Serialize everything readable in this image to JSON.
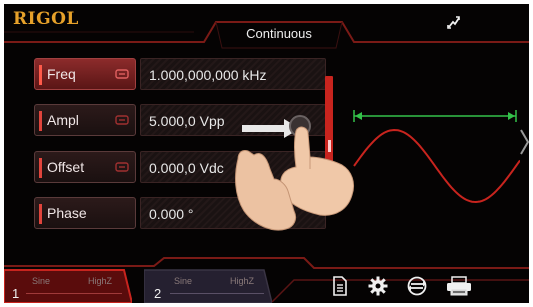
{
  "header": {
    "brand": "RIGOL",
    "mode_title": "Continuous"
  },
  "parameters": [
    {
      "label": "Freq",
      "value": "1.000,000,000 kHz",
      "active": true,
      "has_lock": true
    },
    {
      "label": "Ampl",
      "value": "5.000,0 Vpp",
      "active": false,
      "has_lock": true
    },
    {
      "label": "Offset",
      "value": "0.000,0 Vdc",
      "active": false,
      "has_lock": true
    },
    {
      "label": "Phase",
      "value": "0.000 °",
      "active": false,
      "has_lock": false
    }
  ],
  "channels": [
    {
      "number": "1",
      "waveform": "Sine",
      "load": "HighZ",
      "active": true
    },
    {
      "number": "2",
      "waveform": "Sine",
      "load": "HighZ",
      "active": false
    }
  ],
  "footer_icons": [
    "document-icon",
    "gear-icon",
    "channel-swap-icon",
    "printer-icon"
  ],
  "colors": {
    "brand": "#e6a12a",
    "accent_red": "#c8241e",
    "period_marker": "#34c24a",
    "background": "#050303"
  }
}
